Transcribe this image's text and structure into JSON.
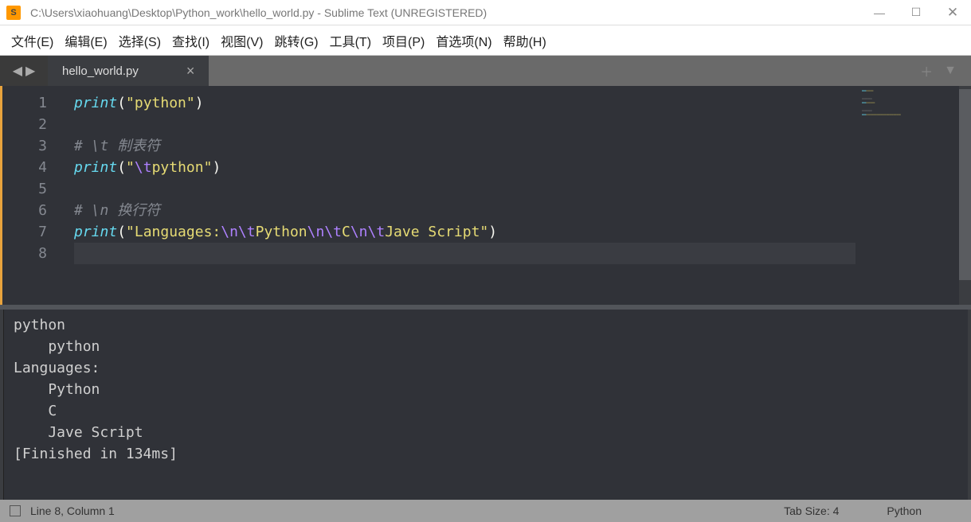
{
  "window": {
    "title": "C:\\Users\\xiaohuang\\Desktop\\Python_work\\hello_world.py - Sublime Text (UNREGISTERED)",
    "minimize": "—",
    "maximize": "☐",
    "close": "✕"
  },
  "menu": {
    "file": "文件(E)",
    "edit": "编辑(E)",
    "select": "选择(S)",
    "find": "查找(I)",
    "view": "视图(V)",
    "goto": "跳转(G)",
    "tools": "工具(T)",
    "project": "项目(P)",
    "preferences": "首选项(N)",
    "help": "帮助(H)"
  },
  "tabs": {
    "nav_back": "◀",
    "nav_fwd": "▶",
    "active": {
      "label": "hello_world.py",
      "close": "×"
    },
    "add": "＋",
    "menu": "▼"
  },
  "editor": {
    "line_numbers": [
      "1",
      "2",
      "3",
      "4",
      "5",
      "6",
      "7",
      "8"
    ],
    "lines": [
      {
        "type": "code",
        "fn": "print",
        "open": "(",
        "str_open": "\"",
        "str": "python",
        "str_close": "\"",
        "close": ")"
      },
      {
        "type": "blank"
      },
      {
        "type": "comment",
        "text": "# \\t 制表符"
      },
      {
        "type": "code_esc",
        "fn": "print",
        "open": "(",
        "str_open": "\"",
        "parts": [
          {
            "esc": "\\t"
          },
          {
            "txt": "python"
          }
        ],
        "str_close": "\"",
        "close": ")"
      },
      {
        "type": "blank"
      },
      {
        "type": "comment",
        "text": "# \\n 换行符"
      },
      {
        "type": "code_esc",
        "fn": "print",
        "open": "(",
        "str_open": "\"",
        "parts": [
          {
            "txt": "Languages:"
          },
          {
            "esc": "\\n\\t"
          },
          {
            "txt": "Python"
          },
          {
            "esc": "\\n\\t"
          },
          {
            "txt": "C"
          },
          {
            "esc": "\\n\\t"
          },
          {
            "txt": "Jave Script"
          }
        ],
        "str_close": "\"",
        "close": ")"
      },
      {
        "type": "highlight"
      }
    ]
  },
  "output": {
    "text": "python\n    python\nLanguages:\n    Python\n    C\n    Jave Script\n[Finished in 134ms]"
  },
  "status": {
    "position": "Line 8, Column 1",
    "tab_size": "Tab Size: 4",
    "syntax": "Python"
  }
}
